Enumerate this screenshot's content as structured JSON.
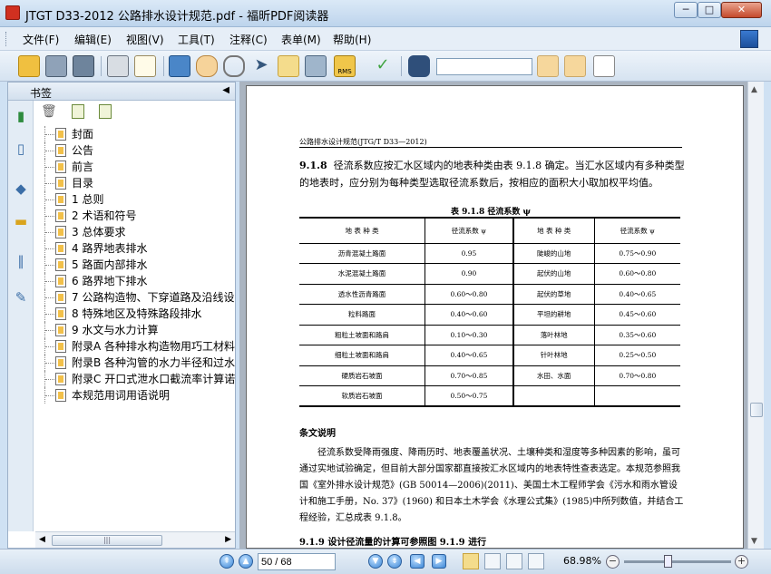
{
  "window": {
    "title": "JTGT D33-2012 公路排水设计规范.pdf - 福昕PDF阅读器",
    "min": "─",
    "max": "□",
    "close": "✕"
  },
  "menu": [
    "文件(F)",
    "编辑(E)",
    "视图(V)",
    "工具(T)",
    "注释(C)",
    "表单(M)",
    "帮助(H)"
  ],
  "toolbar": {
    "search_value": "",
    "icons": [
      "open-folder-icon",
      "save-icon",
      "save-as-icon",
      "print-icon",
      "email-icon",
      "fullscreen-icon",
      "hand-icon",
      "zoom-icon",
      "select-arrow-icon",
      "text-select-icon",
      "snapshot-icon",
      "rms-lock-icon",
      "sign-icon",
      "find-binoculars-icon",
      "prev-find-icon",
      "next-find-icon",
      "highlight-icon"
    ],
    "rms_label": "RMS"
  },
  "sidebar": {
    "title": "书签",
    "collapse": "◀",
    "bookmarks": [
      "封面",
      "公告",
      "前言",
      "目录",
      "1 总则",
      "2 术语和符号",
      "3 总体要求",
      "4 路界地表排水",
      "5 路面内部排水",
      "6 路界地下排水",
      "7 公路构造物、下穿道路及沿线设",
      "8 特殊地区及特殊路段排水",
      "9 水文与水力计算",
      "附录A 各种排水构造物用巧工材料",
      "附录B 各种沟管的水力半径和过水",
      "附录C 开口式泄水口截流率计算诺",
      "本规范用词用语说明"
    ]
  },
  "page": {
    "running_head": "公路排水设计规范(JTG/T D33—2012)",
    "section_no": "9.1.8",
    "para1": "径流系数应按汇水区域内的地表种类由表 9.1.8 确定。当汇水区域内有多种类型的地表时，应分别为每种类型选取径流系数后，按相应的面积大小取加权平均值。",
    "table_caption": "表 9.1.8   径流系数 ψ",
    "table_header": [
      "地 表 种 类",
      "径流系数 ψ",
      "地 表 种 类",
      "径流系数 ψ"
    ],
    "table_rows": [
      [
        "沥青混凝土路面",
        "0.95",
        "陡峻的山地",
        "0.75～0.90"
      ],
      [
        "水泥混凝土路面",
        "0.90",
        "起伏的山地",
        "0.60～0.80"
      ],
      [
        "透水性沥青路面",
        "0.60～0.80",
        "起伏的草地",
        "0.40～0.65"
      ],
      [
        "粒料路面",
        "0.40～0.60",
        "平坦的耕地",
        "0.45～0.60"
      ],
      [
        "粗粒土坡面和路肩",
        "0.10～0.30",
        "落叶林地",
        "0.35～0.60"
      ],
      [
        "细粒土坡面和路肩",
        "0.40～0.65",
        "针叶林地",
        "0.25～0.50"
      ],
      [
        "硬质岩石坡面",
        "0.70～0.85",
        "水田、水面",
        "0.70～0.80"
      ],
      [
        "软质岩石坡面",
        "0.50～0.75",
        "",
        ""
      ]
    ],
    "section_heading": "条文说明",
    "para2": "径流系数受降雨强度、降雨历时、地表覆盖状况、土壤种类和湿度等多种因素的影响，虽可通过实地试验确定，但目前大部分国家都直接按汇水区域内的地表特性查表选定。本规范参照我国《室外排水设计规范》(GB 50014—2006)(2011)、美国土木工程师学会《污水和雨水管设计和施工手册，No. 37》(1960) 和日本土木学会《水理公式集》(1985)中所列数值，并结合工程经验，汇总成表 9.1.8。",
    "para3": "9.1.9   设计径流量的计算可参照图 9.1.9 进行"
  },
  "status": {
    "page_value": "50 / 68",
    "zoom": "68.98%"
  }
}
